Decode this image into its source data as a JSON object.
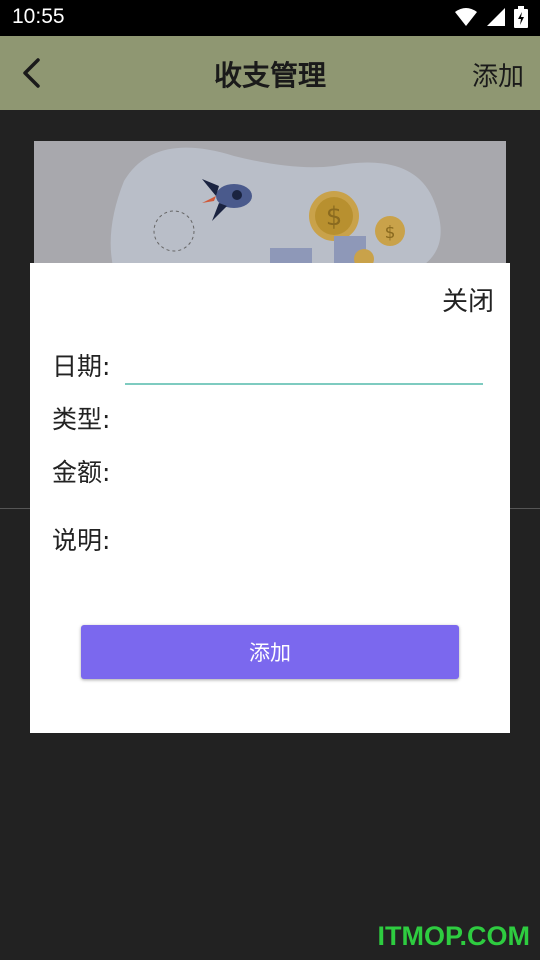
{
  "status_bar": {
    "time": "10:55",
    "icons": [
      "wifi-icon",
      "signal-icon",
      "battery-charging-icon"
    ]
  },
  "app_bar": {
    "back_icon": "chevron-left-icon",
    "title": "收支管理",
    "action_label": "添加"
  },
  "banner": {
    "description_icons": [
      "rocket-icon",
      "coin-icon"
    ]
  },
  "dialog": {
    "close_label": "关闭",
    "fields": {
      "date_label": "日期:",
      "date_value": "",
      "type_label": "类型:",
      "amount_label": "金额:",
      "note_label": "说明:"
    },
    "submit_label": "添加"
  },
  "watermark": "ITMOP.COM",
  "colors": {
    "app_bar": "#8f9772",
    "accent_button": "#7b68ee",
    "input_underline": "#7ecbc0",
    "watermark": "#2ecc40"
  }
}
